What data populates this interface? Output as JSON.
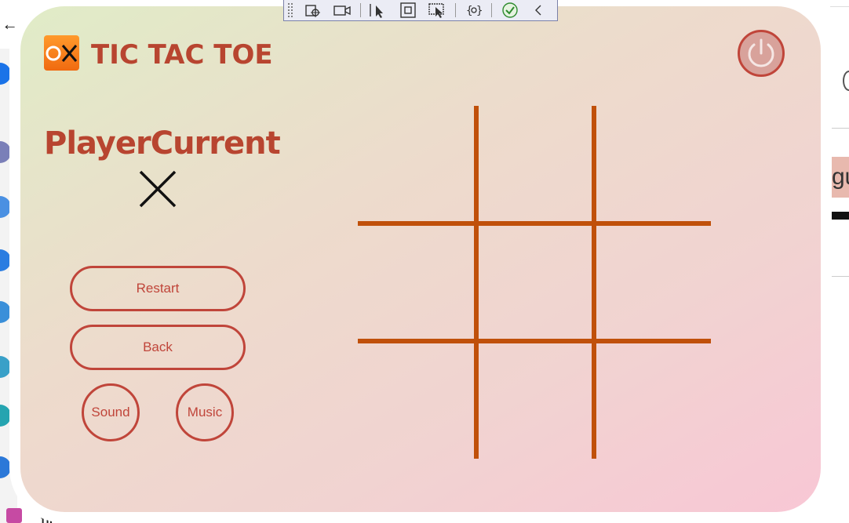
{
  "app": {
    "title": "TIC TAC TOE",
    "logo_text": "OX",
    "current_player_label": "PlayerCurrent",
    "current_player_mark": "X"
  },
  "buttons": {
    "restart": "Restart",
    "back": "Back",
    "sound": "Sound",
    "music": "Music"
  },
  "board": {
    "rows": 3,
    "cols": 3,
    "cells": [
      "",
      "",
      "",
      "",
      "",
      "",
      "",
      "",
      ""
    ]
  },
  "debug_toolbar": {
    "icons": [
      "select-element-icon",
      "record-icon",
      "pointer-icon",
      "frame-icon",
      "display-layout-icon",
      "binding-icon",
      "check-icon",
      "collapse-chevron-icon"
    ]
  },
  "background": {
    "bottom_text": "tic",
    "right_chip_text": "gu"
  },
  "colors": {
    "accent": "#c0453a",
    "title": "#b84530",
    "grid": "#c0500a",
    "gradient_start": "#e0ecc7",
    "gradient_end": "#f8c7d5"
  }
}
